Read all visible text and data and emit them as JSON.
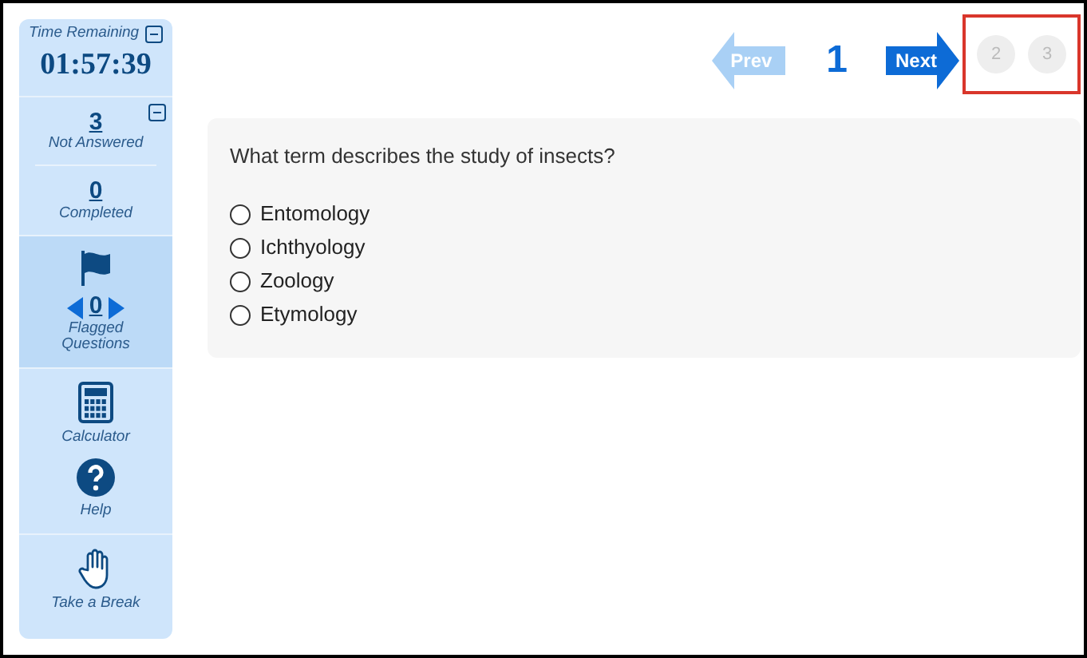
{
  "sidebar": {
    "timer": {
      "label": "Time Remaining",
      "value": "01:57:39"
    },
    "counts": [
      {
        "value": "3",
        "label": "Not Answered"
      },
      {
        "value": "0",
        "label": "Completed"
      }
    ],
    "flagged": {
      "value": "0",
      "label": "Flagged Questions"
    },
    "tools": [
      {
        "kind": "calculator",
        "label": "Calculator"
      },
      {
        "kind": "help",
        "label": "Help"
      },
      {
        "kind": "break",
        "label": "Take a Break"
      }
    ]
  },
  "nav": {
    "prev": {
      "label": "Prev",
      "disabled": true
    },
    "current": "1",
    "next": {
      "label": "Next",
      "disabled": false
    },
    "pages": [
      {
        "label": "2",
        "selected": false
      },
      {
        "label": "3",
        "selected": false
      }
    ]
  },
  "question": {
    "text": "What term describes the study of insects?",
    "options": [
      {
        "label": "Entomology",
        "selected": false
      },
      {
        "label": "Ichthyology",
        "selected": false
      },
      {
        "label": "Zoology",
        "selected": false
      },
      {
        "label": "Etymology",
        "selected": false
      }
    ]
  }
}
